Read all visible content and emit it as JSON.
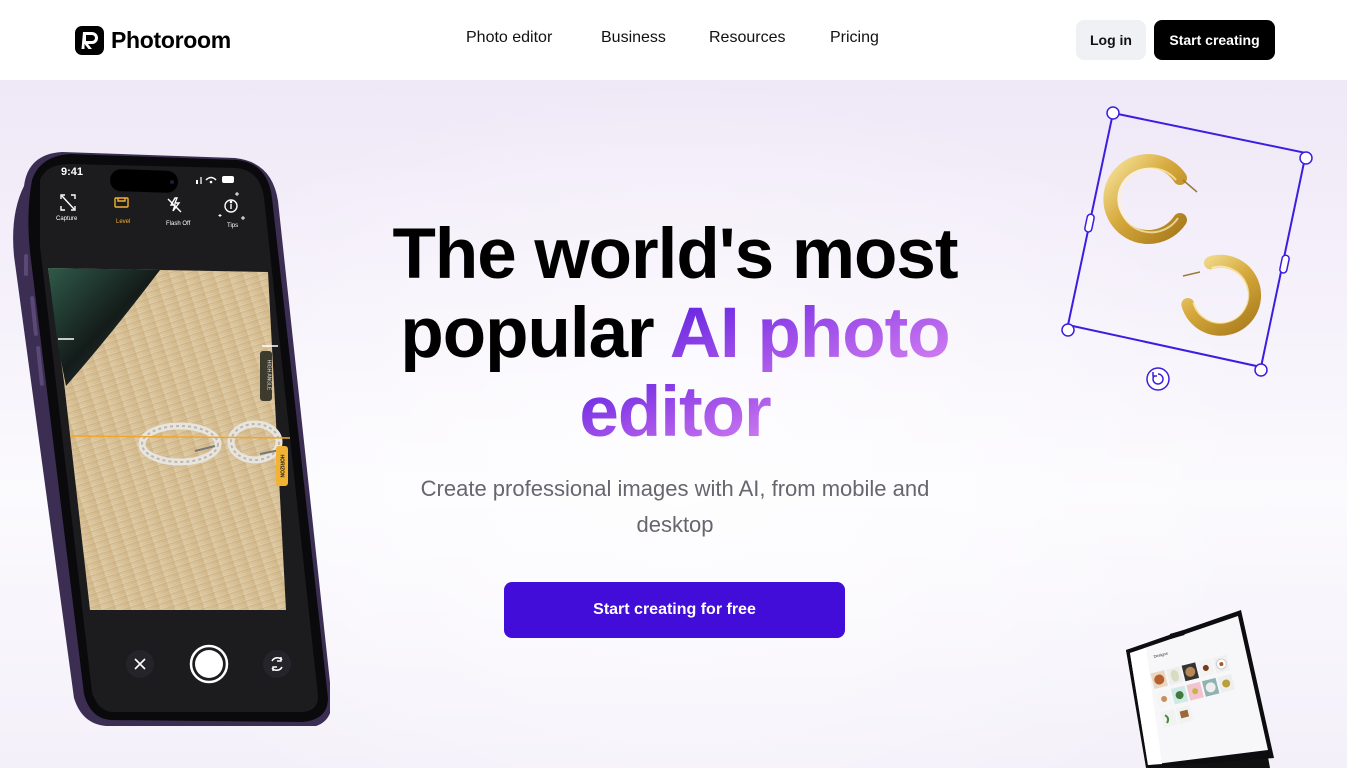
{
  "header": {
    "brand": "Photoroom",
    "nav": [
      {
        "label": "Photo editor"
      },
      {
        "label": "Business"
      },
      {
        "label": "Resources"
      },
      {
        "label": "Pricing"
      }
    ],
    "login_label": "Log in",
    "start_label": "Start creating"
  },
  "hero": {
    "headline_line1": "The world's most",
    "headline_line2_plain": "popular ",
    "headline_line2_accent": "AI photo",
    "headline_line3_accent": "editor",
    "subheadline": "Create professional images with AI, from mobile and desktop",
    "cta_label": "Start creating for free"
  },
  "phone_mockup": {
    "status_time": "9:41",
    "camera_modes": [
      {
        "label": "Capture",
        "icon": "capture-icon"
      },
      {
        "label": "Level",
        "icon": "level-icon",
        "active": true
      },
      {
        "label": "Flash Off",
        "icon": "flash-off-icon"
      },
      {
        "label": "Tips",
        "icon": "tips-icon"
      }
    ],
    "overlay_tags": [
      "HIGH ANGLE",
      "HORIZON"
    ],
    "controls": [
      "close-icon",
      "shutter-button",
      "flip-camera-icon"
    ]
  },
  "colors": {
    "brand_black": "#000000",
    "cta_purple": "#420cd9",
    "accent_gradient_start": "#5a1fe0",
    "accent_gradient_end": "#d985f2",
    "selection_outline": "#3b1ee0",
    "active_mode": "#f2b233"
  },
  "laptop_mockup": {
    "screen_title": "Designs"
  }
}
